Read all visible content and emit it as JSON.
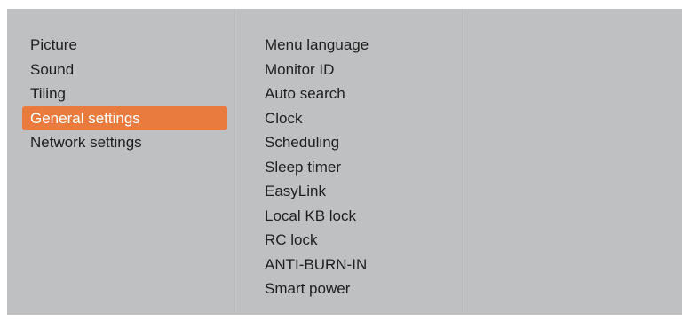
{
  "main_menu": {
    "items": [
      {
        "label": "Picture"
      },
      {
        "label": "Sound"
      },
      {
        "label": "Tiling"
      },
      {
        "label": "General settings"
      },
      {
        "label": "Network settings"
      }
    ],
    "selected_index": 3
  },
  "submenu": {
    "items": [
      {
        "label": "Menu language"
      },
      {
        "label": "Monitor ID"
      },
      {
        "label": "Auto search"
      },
      {
        "label": "Clock"
      },
      {
        "label": "Scheduling"
      },
      {
        "label": "Sleep timer"
      },
      {
        "label": "EasyLink"
      },
      {
        "label": "Local KB lock"
      },
      {
        "label": "RC lock"
      },
      {
        "label": "ANTI-BURN-IN"
      },
      {
        "label": "Smart power"
      }
    ]
  },
  "colors": {
    "panel_background": "#bfc0c2",
    "selection_highlight": "#ea7b3e",
    "text": "#1e1e1e",
    "selected_text": "#ffffff"
  }
}
